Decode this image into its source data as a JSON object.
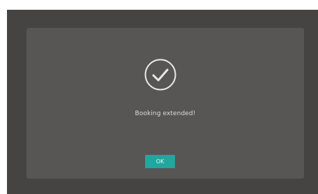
{
  "dialog": {
    "icon": "check-circle-icon",
    "message": "Booking extended!",
    "ok_label": "OK"
  },
  "colors": {
    "background": "#454442",
    "dialog": "#575654",
    "accent": "#21a7a0",
    "text": "#dcdcda"
  }
}
